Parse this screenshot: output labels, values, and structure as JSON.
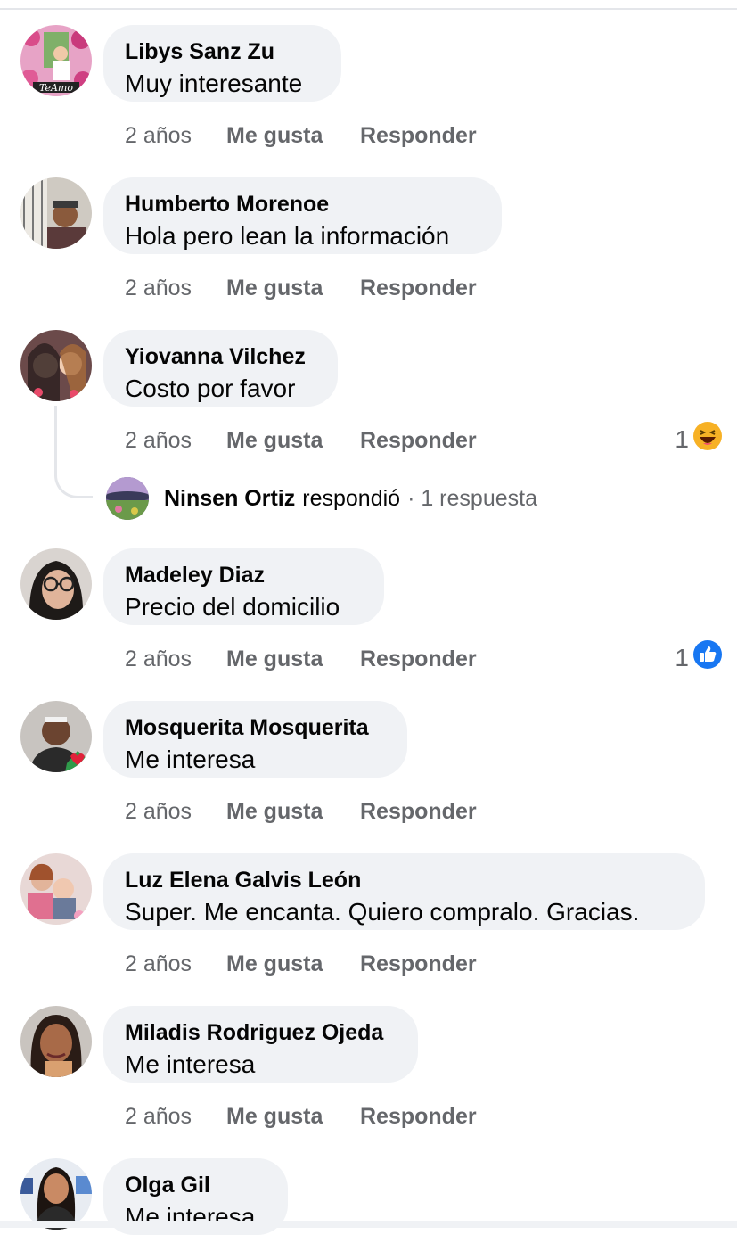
{
  "comments": [
    {
      "author": "Libys Sanz Zu",
      "text": "Muy interesante",
      "time": "2 años",
      "like": "Me gusta",
      "reply": "Responder",
      "avatar_icon": "avatar-photo",
      "avatar_watermark": "TeAmo"
    },
    {
      "author": "Humberto Morenoe",
      "text": "Hola pero lean la información",
      "time": "2 años",
      "like": "Me gusta",
      "reply": "Responder",
      "avatar_icon": "avatar-photo"
    },
    {
      "author": "Yiovanna Vilchez",
      "text": "Costo por favor",
      "time": "2 años",
      "like": "Me gusta",
      "reply": "Responder",
      "avatar_icon": "avatar-photo",
      "reaction": {
        "count": "1",
        "icon": "haha-emoji-icon"
      }
    },
    {
      "author": "Madeley Diaz",
      "text": "Precio del domicilio",
      "time": "2 años",
      "like": "Me gusta",
      "reply": "Responder",
      "avatar_icon": "avatar-photo",
      "reaction": {
        "count": "1",
        "icon": "like-thumb-icon"
      }
    },
    {
      "author": "Mosquerita Mosquerita",
      "text": "Me interesa",
      "time": "2 años",
      "like": "Me gusta",
      "reply": "Responder",
      "avatar_icon": "avatar-photo"
    },
    {
      "author": "Luz Elena Galvis León",
      "text": "Super. Me encanta. Quiero compralo. Gracias.",
      "time": "2 años",
      "like": "Me gusta",
      "reply": "Responder",
      "avatar_icon": "avatar-photo"
    },
    {
      "author": "Miladis Rodriguez Ojeda",
      "text": "Me interesa",
      "time": "2 años",
      "like": "Me gusta",
      "reply": "Responder",
      "avatar_icon": "avatar-photo"
    },
    {
      "author": "Olga Gil",
      "text": "Me interesa",
      "avatar_icon": "avatar-photo"
    }
  ],
  "reply_preview": {
    "name": "Ninsen Ortiz",
    "verb": "respondió",
    "count": "· 1 respuesta"
  },
  "colors": {
    "bubble": "#f0f2f5",
    "meta_text": "#65676b",
    "like_blue": "#1877f2",
    "haha_yellow": "#f7b125"
  }
}
